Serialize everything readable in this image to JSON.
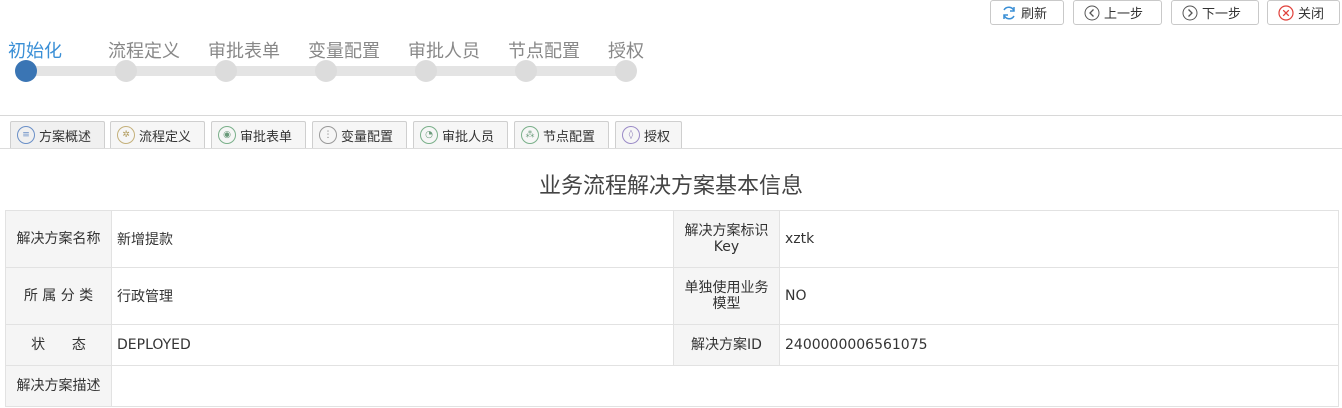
{
  "toolbar": {
    "refresh": "刷新",
    "prev": "上一步",
    "next": "下一步",
    "close": "关闭"
  },
  "steps": [
    "初始化",
    "流程定义",
    "审批表单",
    "变量配置",
    "审批人员",
    "节点配置",
    "授权"
  ],
  "active_step": 0,
  "tabs": [
    "方案概述",
    "流程定义",
    "审批表单",
    "变量配置",
    "审批人员",
    "节点配置",
    "授权"
  ],
  "active_tab": 0,
  "title": "业务流程解决方案基本信息",
  "fields": {
    "name_label": "解决方案名称",
    "name_value": "新增提款",
    "key_label": "解决方案标识Key",
    "key_value": "xztk",
    "category_label": "所 属 分 类",
    "category_value": "行政管理",
    "standalone_label": "单独使用业务模型",
    "standalone_value": "NO",
    "status_label": "状      态",
    "status_value": "DEPLOYED",
    "id_label": "解决方案ID",
    "id_value": "2400000006561075",
    "desc_label": "解决方案描述",
    "desc_value": ""
  },
  "colors": {
    "accent": "#3a8fd6",
    "active_dot": "#3a75b4"
  }
}
